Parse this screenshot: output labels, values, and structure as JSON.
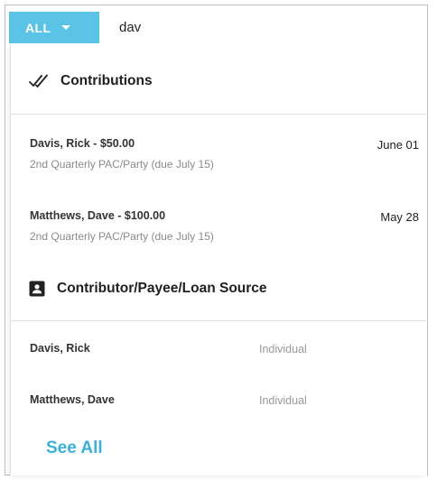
{
  "search": {
    "filter_label": "ALL",
    "query": "dav"
  },
  "sections": {
    "contributions": {
      "title": "Contributions",
      "icon": "double-check-icon",
      "items": [
        {
          "primary": "Davis, Rick - $50.00",
          "secondary": "2nd Quarterly PAC/Party (due July 15)",
          "date": "June 01"
        },
        {
          "primary": "Matthews, Dave - $100.00",
          "secondary": "2nd Quarterly PAC/Party (due July 15)",
          "date": "May 28"
        }
      ]
    },
    "contacts": {
      "title": "Contributor/Payee/Loan Source",
      "icon": "contact-card-icon",
      "items": [
        {
          "name": "Davis, Rick",
          "type": "Individual"
        },
        {
          "name": "Matthews, Dave",
          "type": "Individual"
        }
      ]
    }
  },
  "footer": {
    "see_all_label": "See All"
  },
  "colors": {
    "accent": "#5bc3e6",
    "link": "#3ab0de"
  }
}
